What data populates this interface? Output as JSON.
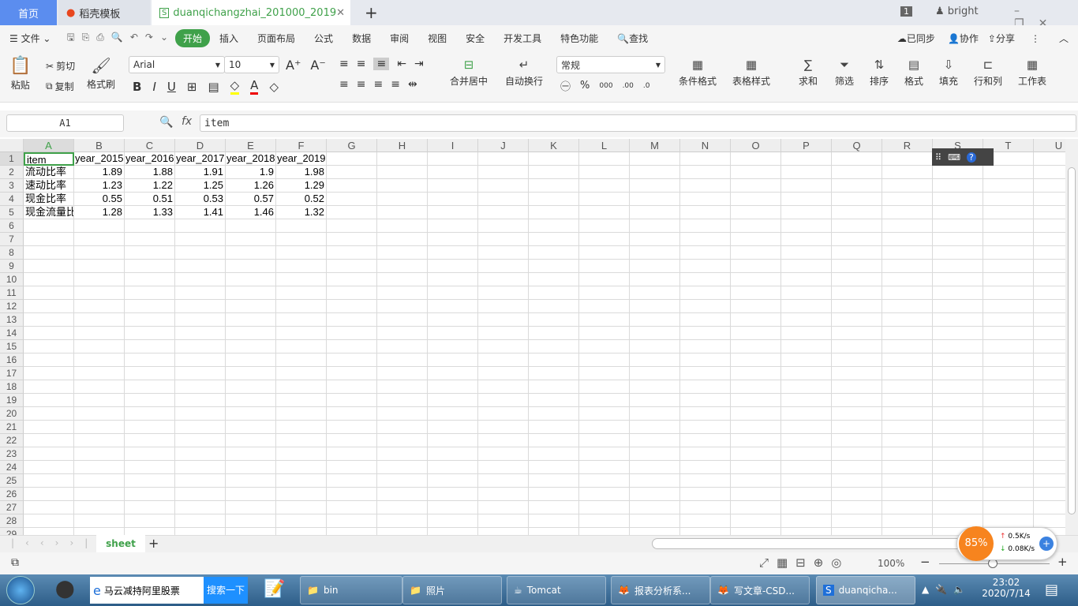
{
  "tabs": [
    {
      "label": "首页"
    },
    {
      "label": "稻壳模板"
    },
    {
      "label": "duanqichangzhai_201000_2019"
    }
  ],
  "window": {
    "badge": "1",
    "user": "bright"
  },
  "menu": {
    "file": "文件",
    "items": [
      "开始",
      "插入",
      "页面布局",
      "公式",
      "数据",
      "审阅",
      "视图",
      "安全",
      "开发工具",
      "特色功能"
    ],
    "search": "查找",
    "sync": "已同步",
    "collab": "协作",
    "share": "分享"
  },
  "toolbar": {
    "paste": "粘贴",
    "cut": "剪切",
    "copy": "复制",
    "format_painter": "格式刷",
    "font": "Arial",
    "size": "10",
    "merge": "合并居中",
    "wrap": "自动换行",
    "number_format": "常规",
    "cond_format": "条件格式",
    "table_style": "表格样式",
    "sum": "求和",
    "filter": "筛选",
    "sort": "排序",
    "format": "格式",
    "fill": "填充",
    "rowcol": "行和列",
    "sheet": "工作表"
  },
  "formula": {
    "cell_ref": "A1",
    "fx": "fx",
    "value": "item"
  },
  "columns": [
    "A",
    "B",
    "C",
    "D",
    "E",
    "F",
    "G",
    "H",
    "I",
    "J",
    "K",
    "L",
    "M",
    "N",
    "O",
    "P",
    "Q",
    "R",
    "S",
    "T",
    "U"
  ],
  "rows": [
    [
      "item",
      "year_2015",
      "year_2016",
      "year_2017",
      "year_2018",
      "year_2019"
    ],
    [
      "流动比率",
      "1.89",
      "1.88",
      "1.91",
      "1.9",
      "1.98"
    ],
    [
      "速动比率",
      "1.23",
      "1.22",
      "1.25",
      "1.26",
      "1.29"
    ],
    [
      "现金比率",
      "0.55",
      "0.51",
      "0.53",
      "0.57",
      "0.52"
    ],
    [
      "现金流量比",
      "1.28",
      "1.33",
      "1.41",
      "1.46",
      "1.32"
    ]
  ],
  "row_count": 29,
  "sheet_tab": "sheet",
  "status": {
    "zoom": "100%"
  },
  "netmon": {
    "percent": "85%",
    "up": "0.5K/s",
    "down": "0.08K/s"
  },
  "taskbar": {
    "ie_text": "马云减持阿里股票",
    "search_btn": "搜索一下",
    "items": [
      "bin",
      "照片",
      "Tomcat",
      "报表分析系...",
      "写文章-CSD...",
      "duanqicha..."
    ],
    "time": "23:02",
    "date": "2020/7/14"
  },
  "colors": {
    "accent": "#3fa14a",
    "selected_border": "#3fa14a",
    "tab_home": "#5b8def"
  }
}
